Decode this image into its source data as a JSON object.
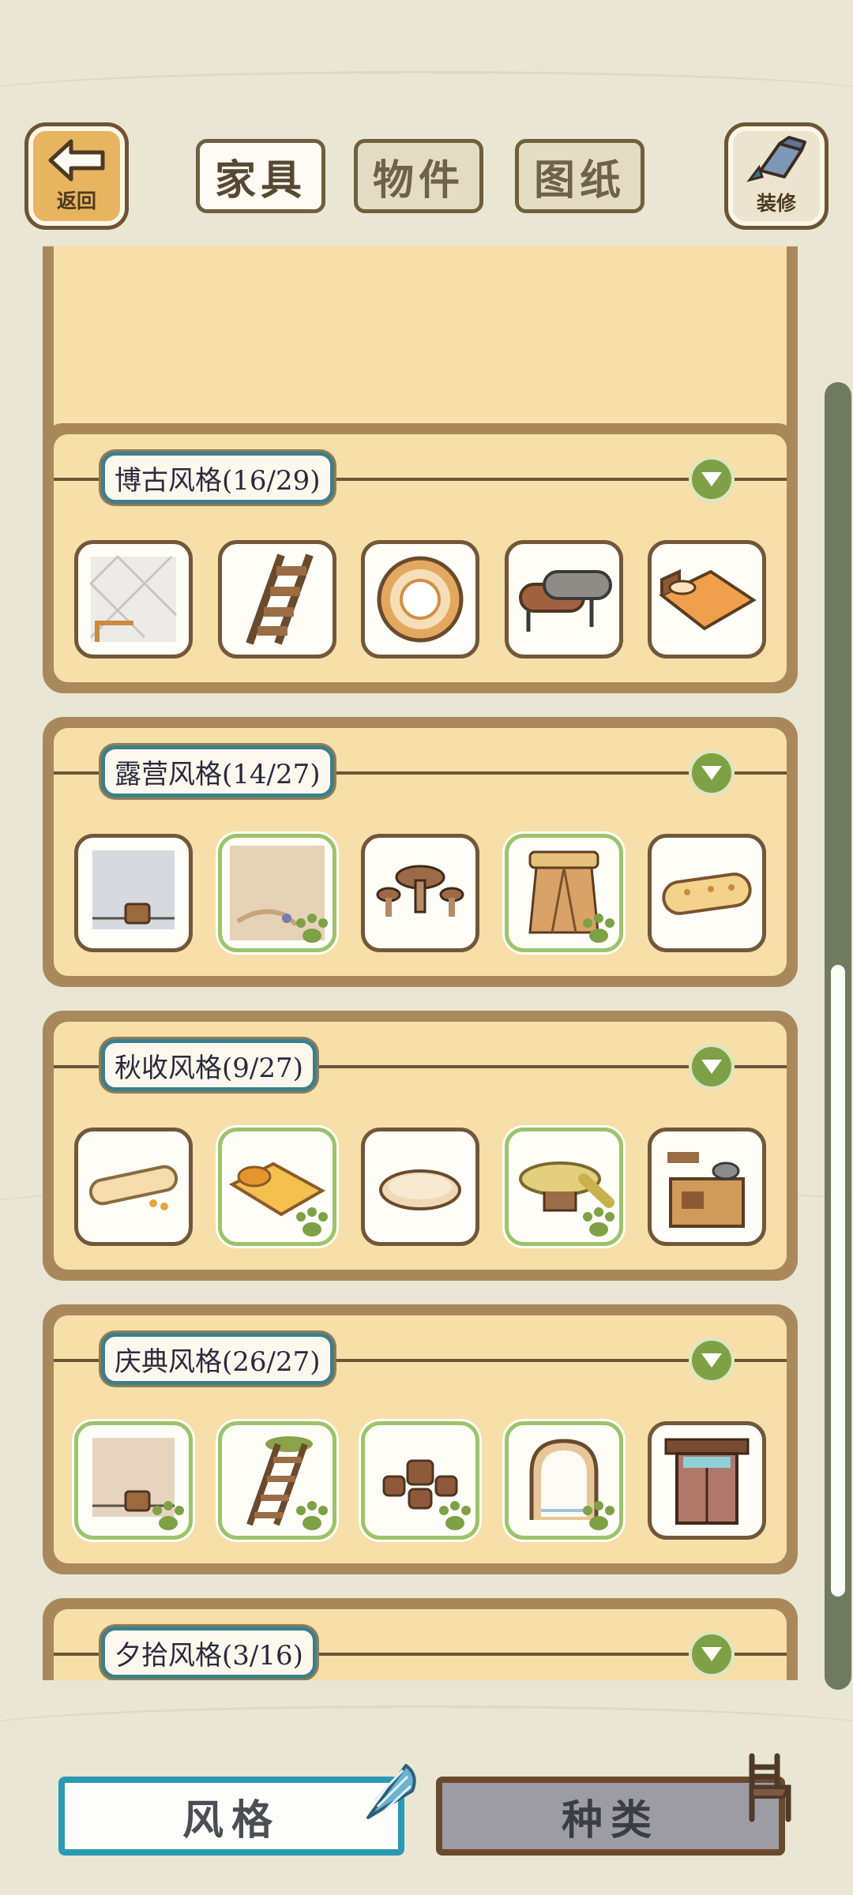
{
  "top_bar": {
    "back_label": "返回",
    "decorate_label": "装修",
    "tabs": [
      {
        "label": "家具",
        "active": true
      },
      {
        "label": "物件",
        "active": false
      },
      {
        "label": "图纸",
        "active": false
      }
    ]
  },
  "style_groups": [
    {
      "title": "",
      "items": [
        {
          "icon": "stone-wall-bucket-icon",
          "owned": false
        },
        {
          "icon": "stream-floor-icon",
          "owned": false
        },
        {
          "icon": "white-ladder-icon",
          "owned": false
        },
        {
          "icon": "stone-arch-icon",
          "owned": false
        },
        {
          "icon": "round-window-icon",
          "owned": false
        }
      ]
    },
    {
      "title": "博古风格(16/29)",
      "items": [
        {
          "icon": "tile-wall-icon",
          "owned": false
        },
        {
          "icon": "wooden-ladder-icon",
          "owned": false
        },
        {
          "icon": "round-rug-icon",
          "owned": false
        },
        {
          "icon": "log-bench-icon",
          "owned": false
        },
        {
          "icon": "orange-bed-icon",
          "owned": false
        }
      ]
    },
    {
      "title": "露营风格(14/27)",
      "items": [
        {
          "icon": "stone-wall-bucket-icon",
          "owned": false
        },
        {
          "icon": "sand-floor-icon",
          "owned": true
        },
        {
          "icon": "mushroom-table-icon",
          "owned": false
        },
        {
          "icon": "tent-icon",
          "owned": true
        },
        {
          "icon": "sleeping-bag-icon",
          "owned": false
        }
      ]
    },
    {
      "title": "秋收风格(9/27)",
      "items": [
        {
          "icon": "rolled-mat-icon",
          "owned": false
        },
        {
          "icon": "harvest-bed-icon",
          "owned": true
        },
        {
          "icon": "straw-cushion-icon",
          "owned": false
        },
        {
          "icon": "leaf-table-icon",
          "owned": true
        },
        {
          "icon": "stove-shelf-icon",
          "owned": false
        }
      ]
    },
    {
      "title": "庆典风格(26/27)",
      "items": [
        {
          "icon": "wall-bucket-icon",
          "owned": true
        },
        {
          "icon": "grass-ladder-icon",
          "owned": true
        },
        {
          "icon": "stump-stools-icon",
          "owned": true
        },
        {
          "icon": "arch-window-icon",
          "owned": true
        },
        {
          "icon": "wooden-door-icon",
          "owned": false
        }
      ]
    },
    {
      "title": "夕拾风格(3/16)",
      "items": []
    }
  ],
  "bottom_tabs": {
    "style_label": "风格",
    "kind_label": "种类"
  },
  "colors": {
    "card_frame": "#a9895c",
    "card_fill": "#f7dfaa",
    "owned_border": "#9cc46a",
    "accent_blue": "#2b9ab4"
  }
}
